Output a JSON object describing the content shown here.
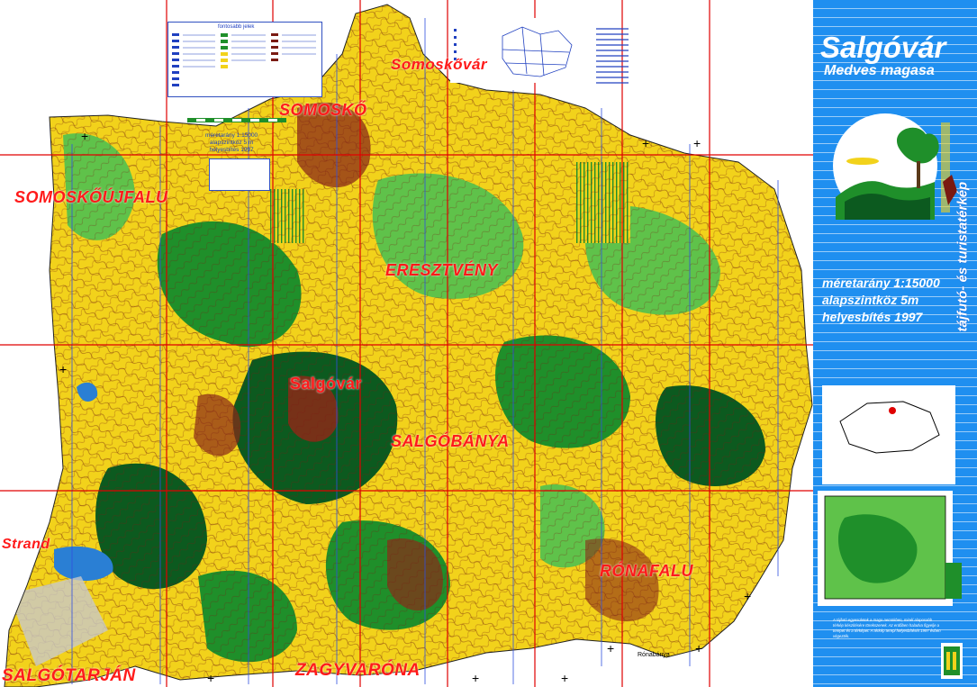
{
  "map": {
    "places": [
      {
        "name": "Somoskővár"
      },
      {
        "name": "SOMOSKŐ"
      },
      {
        "name": "SOMOSKŐÚJFALU"
      },
      {
        "name": "ERESZTVÉNY"
      },
      {
        "name": "Salgóvár"
      },
      {
        "name": "SALGÓBÁNYA"
      },
      {
        "name": "Strand"
      },
      {
        "name": "RÓNAFALU"
      },
      {
        "name": "SALGÓTARJÁN"
      },
      {
        "name": "ZAGYVARÓNA"
      },
      {
        "name": "Rónabánya"
      }
    ],
    "legend_heading": "fontosabb jelek",
    "scale_box": {
      "line1": "méretarány 1:15000",
      "line2": "alapszintköz 5 m",
      "line3": "helyesbítés 1997"
    },
    "colors": {
      "yellow_open": "#f2d21b",
      "forest_green": "#1f8f2a",
      "light_green": "#5fc24a",
      "dark_green": "#0c5a1f",
      "brown_rock": "#7a1a12",
      "red_grid": "#e00000",
      "blue_panel": "#1f8ff0",
      "water": "#2a7fd4"
    }
  },
  "panel": {
    "title": "Salgóvár",
    "subtitle": "Medves magasa",
    "scale": "méretarány 1:15000",
    "contour": "alapszintköz 5m",
    "update": "helyesbítés 1997",
    "vertical_label": "tájfutó- és turistatérkép",
    "note": "A tájfutó egyesületek a maga nemükben, minél alaposabb térkép készítésére törekszenek. Az erdőben haladva figyelje a terepet és a térképet. A térkép terepi helyesbítését 1997 évben végezték."
  }
}
